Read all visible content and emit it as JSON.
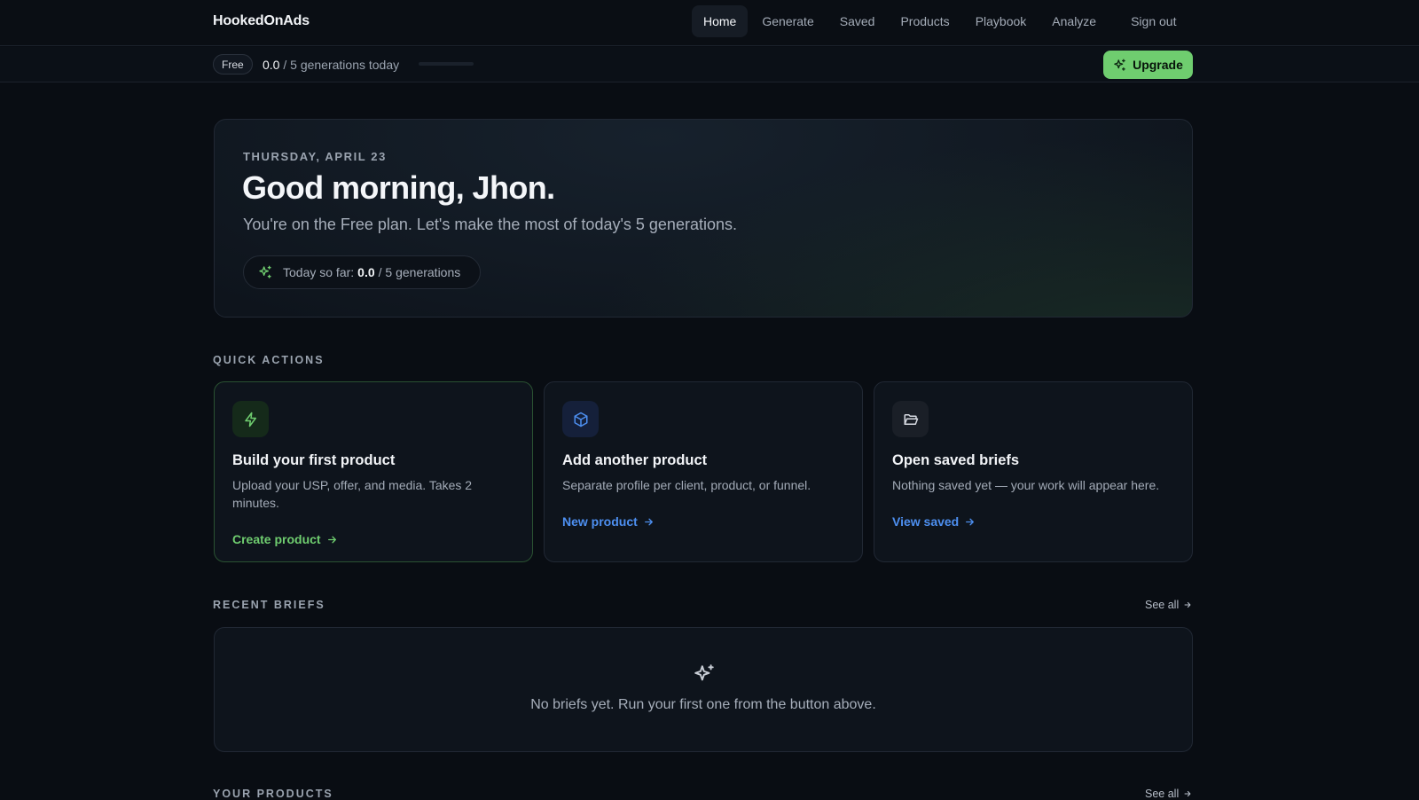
{
  "app": {
    "brand": "HookedOnAds"
  },
  "nav": {
    "items": [
      {
        "label": "Home",
        "active": true
      },
      {
        "label": "Generate"
      },
      {
        "label": "Saved"
      },
      {
        "label": "Products"
      },
      {
        "label": "Playbook"
      },
      {
        "label": "Analyze"
      }
    ],
    "sign_out": "Sign out"
  },
  "usage": {
    "plan": "Free",
    "used": "0.0",
    "text": "/ 5 generations today",
    "progress_fraction": 0.0,
    "upgrade_label": "Upgrade",
    "icon": "sparkles-icon"
  },
  "hero": {
    "date": "THURSDAY, APRIL 23",
    "greeting": "Good morning, Jhon.",
    "subtitle": "You're on the Free plan. Let's make the most of today's 5 generations.",
    "chip_prefix": "Today so far:",
    "chip_used": "0.0",
    "chip_suffix": "/ 5 generations"
  },
  "quick_actions": {
    "label": "QUICK ACTIONS",
    "cards": [
      {
        "icon": "lightning-icon",
        "title": "Build your first product",
        "description": "Upload your USP, offer, and media. Takes 2 minutes.",
        "link": "Create product",
        "accent": "#6fcd6f"
      },
      {
        "icon": "cube-icon",
        "title": "Add another product",
        "description": "Separate profile per client, product, or funnel.",
        "link": "New product",
        "accent": "#4d8ff0"
      },
      {
        "icon": "folder-open-icon",
        "title": "Open saved briefs",
        "description": "Nothing saved yet — your work will appear here.",
        "link": "View saved",
        "accent": "#4d8ff0"
      }
    ]
  },
  "recent_briefs": {
    "label": "RECENT BRIEFS",
    "see_all": "See all",
    "empty_text": "No briefs yet. Run your first one from the button above."
  },
  "your_products": {
    "label": "YOUR PRODUCTS",
    "see_all": "See all"
  },
  "colors": {
    "background": "#090d13",
    "accent_green": "#6fcd6f",
    "accent_blue": "#4d8ff0"
  }
}
